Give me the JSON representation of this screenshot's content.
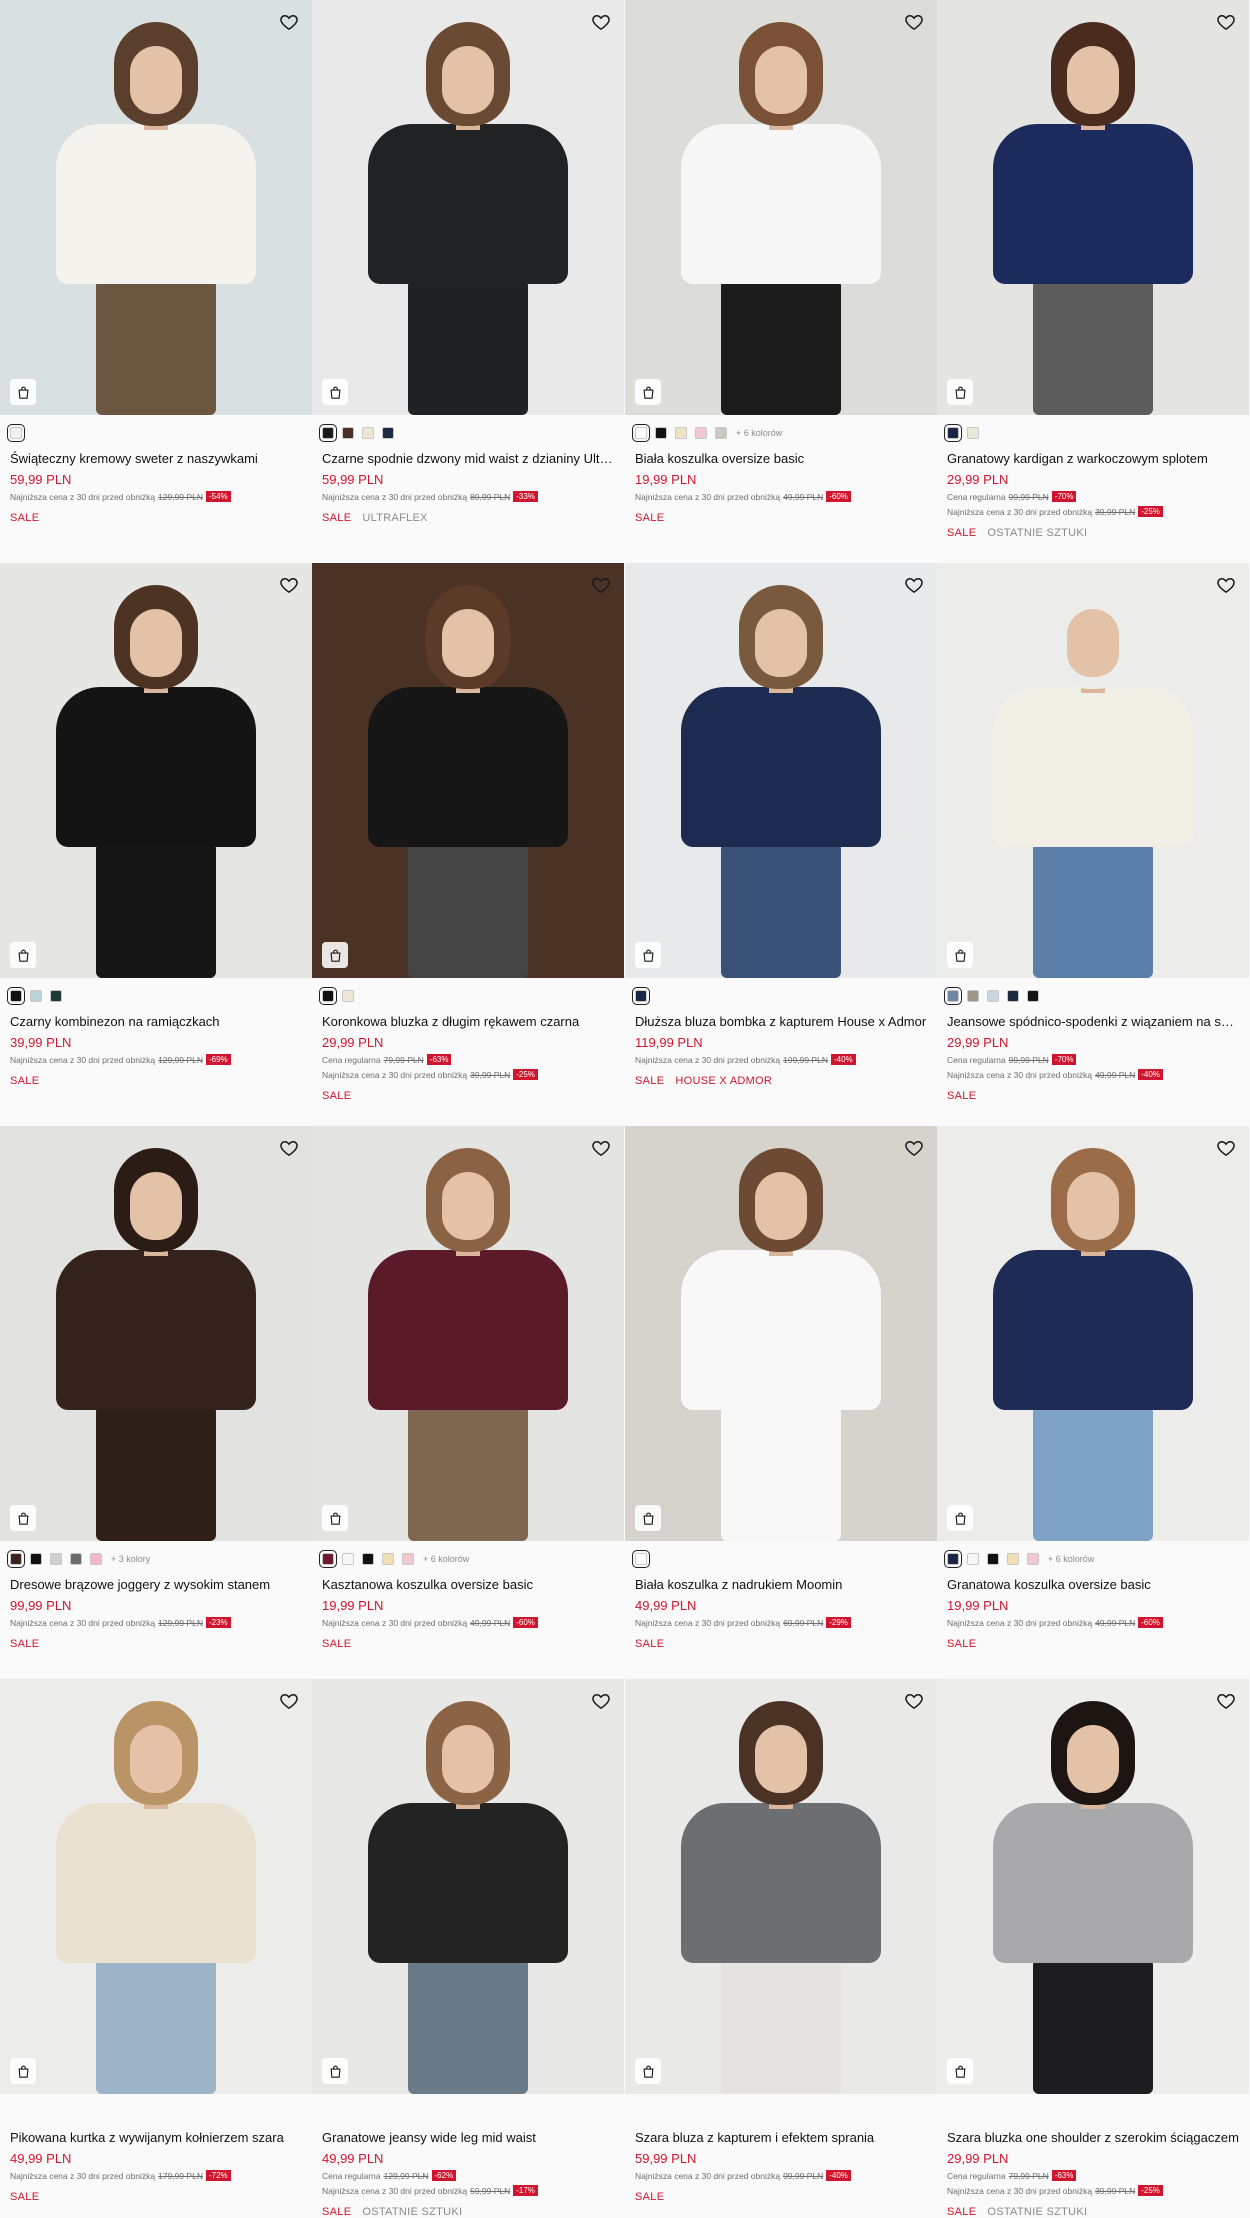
{
  "colors": {
    "sale": "#d1152f",
    "text": "#111111",
    "muted": "#6e6e6e",
    "background": "#fafafa"
  },
  "labels": {
    "lowest_price": "Najniższa cena z 30 dni przed obniżką",
    "regular_price": "Cena regularna",
    "sale": "SALE"
  },
  "icons": {
    "wishlist": "heart-outline-icon",
    "cart": "shopping-bag-icon"
  },
  "products": [
    {
      "name": "Świąteczny kremowy sweter z naszywkami",
      "price": "59,99 PLN",
      "notes": [
        {
          "label": "Najniższa cena z 30 dni przed obniżką",
          "old": "129,99 PLN",
          "pct": "-54%"
        }
      ],
      "swatches": [
        "#f3f1ea"
      ],
      "more": "",
      "tags": [
        "SALE"
      ],
      "photo": {
        "bg": "#d9e0e1",
        "hair": "#5a3f2c",
        "top": "#f4f3ee",
        "bottom": "#6b5740"
      }
    },
    {
      "name": "Czarne spodnie dzwony mid waist z dzianiny Ultraflex",
      "price": "59,99 PLN",
      "notes": [
        {
          "label": "Najniższa cena z 30 dni przed obniżką",
          "old": "89,99 PLN",
          "pct": "-33%"
        }
      ],
      "swatches": [
        "#1a1a1a",
        "#4a2f26",
        "#ece6d3",
        "#1e2a44"
      ],
      "more": "",
      "tags": [
        "SALE",
        "ULTRAFLEX"
      ],
      "photo": {
        "bg": "#e9e9e9",
        "hair": "#6a4a33",
        "top": "#202224",
        "bottom": "#1f2123"
      }
    },
    {
      "name": "Biała koszulka oversize basic",
      "price": "19,99 PLN",
      "notes": [
        {
          "label": "Najniższa cena z 30 dni przed obniżką",
          "old": "49,99 PLN",
          "pct": "-60%"
        }
      ],
      "swatches": [
        "#ffffff",
        "#111111",
        "#efe3c2",
        "#f3c9d1",
        "#c9c9c0"
      ],
      "more": "+ 6 kolorów",
      "tags": [
        "SALE"
      ],
      "photo": {
        "bg": "#dcdcd8",
        "hair": "#7a5136",
        "top": "#f7f7f7",
        "bottom": "#1b1b1b"
      }
    },
    {
      "name": "Granatowy kardigan z warkoczowym splotem",
      "price": "29,99 PLN",
      "notes": [
        {
          "label": "Cena regularna",
          "old": "99,99 PLN",
          "pct": "-70%"
        },
        {
          "label": "Najniższa cena z 30 dni przed obniżką",
          "old": "39,99 PLN",
          "pct": "-25%"
        }
      ],
      "swatches": [
        "#1b2547",
        "#ece8d8"
      ],
      "more": "",
      "tags": [
        "SALE",
        "OSTATNIE SZTUKI"
      ],
      "photo": {
        "bg": "#e4e4e2",
        "hair": "#4a2c1f",
        "top": "#1c2a5c",
        "bottom": "#5d5d5d"
      }
    },
    {
      "name": "Czarny kombinezon na ramiączkach",
      "price": "39,99 PLN",
      "notes": [
        {
          "label": "Najniższa cena z 30 dni przed obniżką",
          "old": "129,99 PLN",
          "pct": "-69%"
        }
      ],
      "swatches": [
        "#111111",
        "#bcd2d9",
        "#1d3a32"
      ],
      "more": "",
      "tags": [
        "SALE"
      ],
      "photo": {
        "bg": "#e6e6e4",
        "hair": "#4d3324",
        "top": "#141414",
        "bottom": "#161616"
      }
    },
    {
      "name": "Koronkowa bluzka z długim rękawem czarna",
      "price": "29,99 PLN",
      "notes": [
        {
          "label": "Cena regularna",
          "old": "79,99 PLN",
          "pct": "-63%"
        },
        {
          "label": "Najniższa cena z 30 dni przed obniżką",
          "old": "39,99 PLN",
          "pct": "-25%"
        }
      ],
      "swatches": [
        "#111111",
        "#ece8d6"
      ],
      "more": "",
      "tags": [
        "SALE"
      ],
      "photo": {
        "bg": "#4a3324",
        "hair": "#5b3b27",
        "top": "#161616",
        "bottom": "#454545"
      }
    },
    {
      "name": "Dłuższa bluza bombka z kapturem House x Admor",
      "price": "119,99 PLN",
      "notes": [
        {
          "label": "Najniższa cena z 30 dni przed obniżką",
          "old": "199,99 PLN",
          "pct": "-40%"
        }
      ],
      "swatches": [
        "#1b2547"
      ],
      "more": "",
      "tags": [
        "SALE",
        "HOUSE X ADMOR"
      ],
      "photo": {
        "bg": "#e7e9ea",
        "hair": "#7a5a3f",
        "top": "#1c2b4f",
        "bottom": "#3b5278"
      }
    },
    {
      "name": "Jeansowe spódnico-spodenki z wiązaniem na sznurek",
      "price": "29,99 PLN",
      "notes": [
        {
          "label": "Cena regularna",
          "old": "99,99 PLN",
          "pct": "-70%"
        },
        {
          "label": "Najniższa cena z 30 dni przed obniżką",
          "old": "49,99 PLN",
          "pct": "-40%"
        }
      ],
      "swatches": [
        "#6f86a3",
        "#9c9886",
        "#c9d5dc",
        "#1b2a3f",
        "#151515"
      ],
      "more": "",
      "tags": [
        "SALE"
      ],
      "photo": {
        "bg": "#ececea",
        "hair": "#ececea",
        "top": "#f2efe6",
        "bottom": "#5b7ea8"
      }
    },
    {
      "name": "Dresowe brązowe joggery z wysokim stanem",
      "price": "99,99 PLN",
      "notes": [
        {
          "label": "Najniższa cena z 30 dni przed obniżką",
          "old": "129,99 PLN",
          "pct": "-23%"
        }
      ],
      "swatches": [
        "#3a241c",
        "#111111",
        "#cfcfcf",
        "#6b6b6b",
        "#f2b8c6"
      ],
      "more": "+ 3 kolory",
      "tags": [
        "SALE"
      ],
      "photo": {
        "bg": "#e2e2e0",
        "hair": "#2b1d16",
        "top": "#34231c",
        "bottom": "#2e1f19"
      }
    },
    {
      "name": "Kasztanowa koszulka oversize basic",
      "price": "19,99 PLN",
      "notes": [
        {
          "label": "Najniższa cena z 30 dni przed obniżką",
          "old": "49,99 PLN",
          "pct": "-60%"
        }
      ],
      "swatches": [
        "#6b1b2c",
        "#f7f7f7",
        "#111111",
        "#efe0b6",
        "#f3c9d1"
      ],
      "more": "+ 6 kolorów",
      "tags": [
        "SALE"
      ],
      "photo": {
        "bg": "#e4e4e2",
        "hair": "#8a6344",
        "top": "#5a1a28",
        "bottom": "#7e6650"
      }
    },
    {
      "name": "Biała koszulka z nadrukiem Moomin",
      "price": "49,99 PLN",
      "notes": [
        {
          "label": "Najniższa cena z 30 dni przed obniżką",
          "old": "69,99 PLN",
          "pct": "-29%"
        }
      ],
      "swatches": [
        "#ffffff"
      ],
      "more": "",
      "tags": [
        "SALE"
      ],
      "photo": {
        "bg": "#d6d2cc",
        "hair": "#6d4a33",
        "top": "#f8f8f8",
        "bottom": "#f8f8f8"
      }
    },
    {
      "name": "Granatowa koszulka oversize basic",
      "price": "19,99 PLN",
      "notes": [
        {
          "label": "Najniższa cena z 30 dni przed obniżką",
          "old": "49,99 PLN",
          "pct": "-60%"
        }
      ],
      "swatches": [
        "#1b2547",
        "#f7f7f7",
        "#111111",
        "#efe0b6",
        "#f3c9d1"
      ],
      "more": "+ 6 kolorów",
      "tags": [
        "SALE"
      ],
      "photo": {
        "bg": "#ececea",
        "hair": "#9a6d48",
        "top": "#1e2c55",
        "bottom": "#7fa3c7"
      }
    },
    {
      "name": "Pikowana kurtka z wywijanym kołnierzem szara",
      "price": "49,99 PLN",
      "notes": [
        {
          "label": "Najniższa cena z 30 dni przed obniżką",
          "old": "179,99 PLN",
          "pct": "-72%"
        }
      ],
      "swatches": [],
      "more": "",
      "tags": [
        "SALE"
      ],
      "photo": {
        "bg": "#ececeb",
        "hair": "#b99466",
        "top": "#e9e0cf",
        "bottom": "#9db3c8"
      }
    },
    {
      "name": "Granatowe jeansy wide leg mid waist",
      "price": "49,99 PLN",
      "notes": [
        {
          "label": "Cena regularna",
          "old": "129,99 PLN",
          "pct": "-62%"
        },
        {
          "label": "Najniższa cena z 30 dni przed obniżką",
          "old": "59,99 PLN",
          "pct": "-17%"
        }
      ],
      "swatches": [],
      "more": "",
      "tags": [
        "SALE",
        "OSTATNIE SZTUKI"
      ],
      "photo": {
        "bg": "#e8e8e6",
        "hair": "#8a6444",
        "top": "#232323",
        "bottom": "#6a7a86"
      }
    },
    {
      "name": "Szara bluza z kapturem i efektem sprania",
      "price": "59,99 PLN",
      "notes": [
        {
          "label": "Najniższa cena z 30 dni przed obniżką",
          "old": "99,99 PLN",
          "pct": "-40%"
        }
      ],
      "swatches": [],
      "more": "",
      "tags": [
        "SALE"
      ],
      "photo": {
        "bg": "#e9e9e8",
        "hair": "#4a3325",
        "top": "#6c6e72",
        "bottom": "#e5e3df"
      }
    },
    {
      "name": "Szara bluzka one shoulder z szerokim ściągaczem",
      "price": "29,99 PLN",
      "notes": [
        {
          "label": "Cena regularna",
          "old": "79,99 PLN",
          "pct": "-63%"
        },
        {
          "label": "Najniższa cena z 30 dni przed obniżką",
          "old": "39,99 PLN",
          "pct": "-25%"
        }
      ],
      "swatches": [],
      "more": "",
      "tags": [
        "SALE",
        "OSTATNIE SZTUKI"
      ],
      "photo": {
        "bg": "#ededec",
        "hair": "#1c1512",
        "top": "#a9a9ab",
        "bottom": "#1d1d1f"
      }
    }
  ]
}
